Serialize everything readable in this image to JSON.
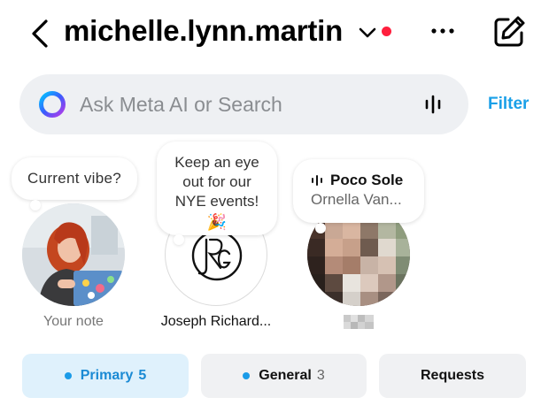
{
  "header": {
    "username": "michelle.lynn.martin",
    "icons": [
      "back-arrow-icon",
      "chevron-down-icon",
      "more-horizontal-icon",
      "compose-icon"
    ],
    "notification_dot_color": "#ff1f3d"
  },
  "search": {
    "placeholder": "Ask Meta AI or Search",
    "filter_label": "Filter",
    "icons": [
      "meta-ai-icon",
      "voice-icon"
    ]
  },
  "notes": [
    {
      "bubble_text": "Current vibe?",
      "label": "Your note"
    },
    {
      "bubble_text_lines": [
        "Keep an eye",
        "out for our",
        "NYE events!"
      ],
      "emoji": "🎉",
      "label": "Joseph Richard..."
    },
    {
      "song_title": "Poco Sole",
      "artist": "Ornella Van...",
      "label": ""
    }
  ],
  "tabs": [
    {
      "label": "Primary",
      "count": "5",
      "active": true
    },
    {
      "label": "General",
      "count": "3",
      "active": false
    },
    {
      "label": "Requests",
      "count": "",
      "active": false
    }
  ],
  "colors": {
    "accent": "#1aa0e8",
    "active_tab_bg": "#dff1fc",
    "inactive_tab_bg": "#f0f1f3"
  }
}
